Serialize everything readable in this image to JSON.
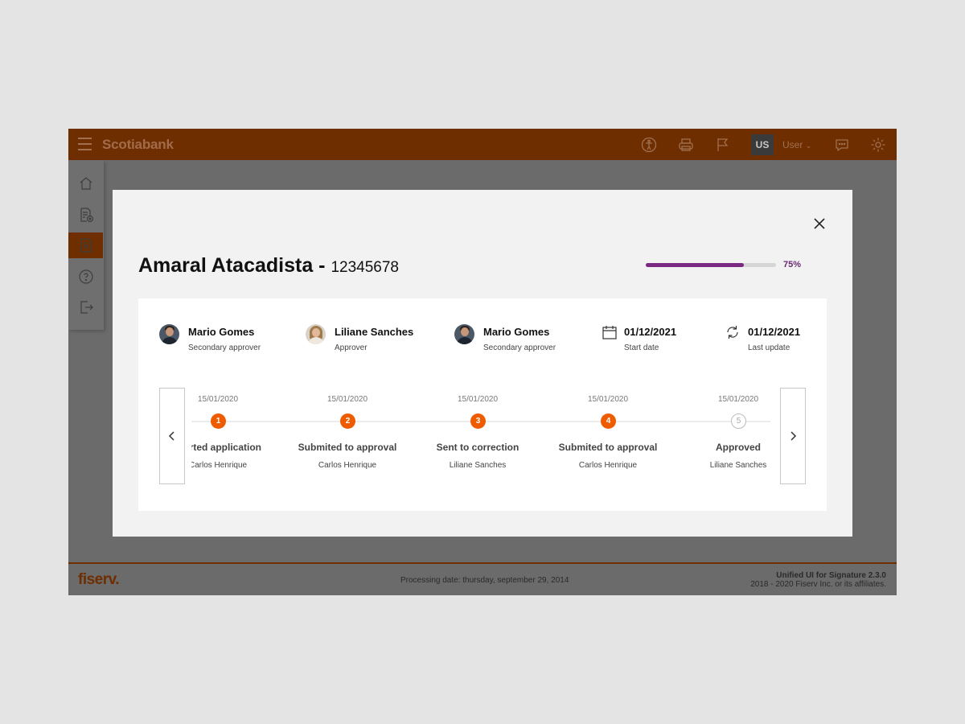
{
  "header": {
    "brand": "Scotiabank",
    "user_badge": "US",
    "user_menu_label": "User"
  },
  "modal": {
    "title": "Amaral Atacadista -",
    "account_number": "12345678",
    "progress_percent": 75,
    "progress_label": "75%"
  },
  "people": [
    {
      "name": "Mario Gomes",
      "role": "Secondary approver"
    },
    {
      "name": "Liliane Sanches",
      "role": "Approver"
    },
    {
      "name": "Mario Gomes",
      "role": "Secondary approver"
    }
  ],
  "dates": [
    {
      "value": "01/12/2021",
      "label": "Start date",
      "icon": "calendar-icon"
    },
    {
      "value": "01/12/2021",
      "label": "Last update",
      "icon": "refresh-icon"
    }
  ],
  "steps": [
    {
      "number": "1",
      "date": "15/01/2020",
      "label": "Started application",
      "person": "Carlos Henrique",
      "status": "done"
    },
    {
      "number": "2",
      "date": "15/01/2020",
      "label": "Submited to approval",
      "person": "Carlos Henrique",
      "status": "done"
    },
    {
      "number": "3",
      "date": "15/01/2020",
      "label": "Sent to correction",
      "person": "Liliane Sanches",
      "status": "done"
    },
    {
      "number": "4",
      "date": "15/01/2020",
      "label": "Submited to approval",
      "person": "Carlos Henrique",
      "status": "done"
    },
    {
      "number": "5",
      "date": "15/01/2020",
      "label": "Approved",
      "person": "Liliane Sanches",
      "status": "pending"
    }
  ],
  "footer": {
    "brand": "fiserv.",
    "processing_date": "Processing date: thursday, september 29, 2014",
    "version": "Unified UI for Signature 2.3.0",
    "copyright": "2018 - 2020 Fiserv Inc. or its affiliates."
  },
  "colors": {
    "header": "#6e2e00",
    "accent": "#ef5c00",
    "progress": "#7a2a82",
    "overlay": "#6b6b6b"
  }
}
